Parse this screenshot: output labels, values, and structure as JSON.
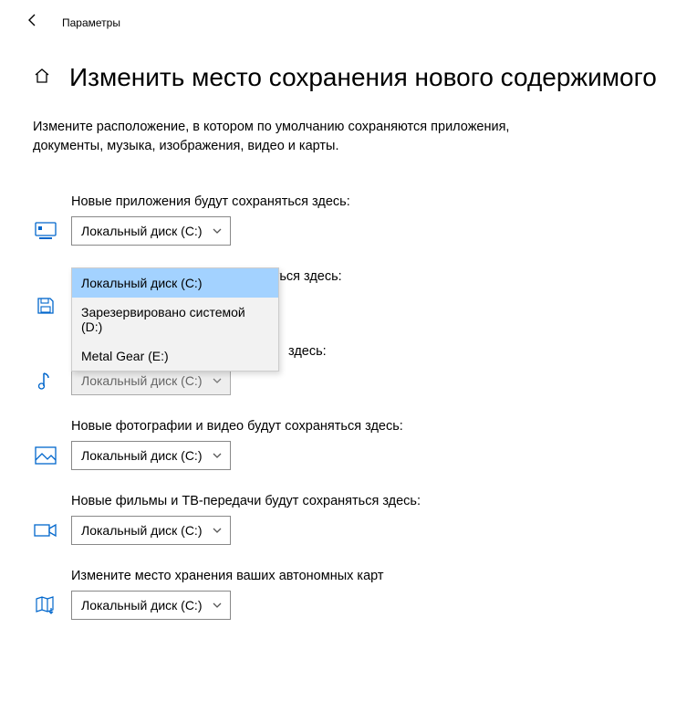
{
  "app": {
    "name": "Параметры"
  },
  "page": {
    "title": "Изменить место сохранения нового содержимого",
    "description": "Измените расположение, в котором по умолчанию сохраняются приложения, документы, музыка, изображения, видео и карты."
  },
  "disk_default": "Локальный диск (C:)",
  "sections": {
    "apps": {
      "label": "Новые приложения будут сохраняться здесь:",
      "value": "Локальный диск (C:)"
    },
    "docs": {
      "label": "Новые документы будут сохраняться здесь:",
      "value": "Локальный диск (C:)"
    },
    "music": {
      "label": "здесь:",
      "value": "Локальный диск (C:)"
    },
    "photos": {
      "label": "Новые фотографии и видео будут сохраняться здесь:",
      "value": "Локальный диск (C:)"
    },
    "movies": {
      "label": "Новые фильмы и ТВ-передачи будут сохраняться здесь:",
      "value": "Локальный диск (C:)"
    },
    "maps": {
      "label": "Измените место хранения ваших автономных карт",
      "value": "Локальный диск (C:)"
    }
  },
  "dropdown_options": [
    "Локальный диск (C:)",
    "Зарезервировано системой (D:)",
    "Metal Gear (E:)"
  ],
  "dropdown_selected_index": 0
}
